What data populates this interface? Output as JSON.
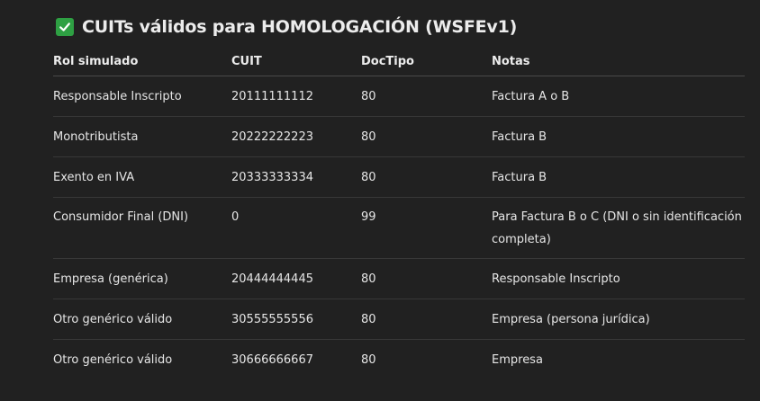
{
  "title": "CUITs válidos para HOMOLOGACIÓN (WSFEv1)",
  "title_icon": "check-mark-button-icon",
  "colors": {
    "background": "#212121",
    "check_green": "#2ea043",
    "text": "#ececec"
  },
  "table": {
    "headers": [
      "Rol simulado",
      "CUIT",
      "DocTipo",
      "Notas"
    ],
    "rows": [
      [
        "Responsable Inscripto",
        "20111111112",
        "80",
        "Factura A o B"
      ],
      [
        "Monotributista",
        "20222222223",
        "80",
        "Factura B"
      ],
      [
        "Exento en IVA",
        "20333333334",
        "80",
        "Factura B"
      ],
      [
        "Consumidor Final (DNI)",
        "0",
        "99",
        "Para Factura B o C (DNI o sin identificación completa)"
      ],
      [
        "Empresa (genérica)",
        "20444444445",
        "80",
        "Responsable Inscripto"
      ],
      [
        "Otro genérico válido",
        "30555555556",
        "80",
        "Empresa (persona jurídica)"
      ],
      [
        "Otro genérico válido",
        "30666666667",
        "80",
        "Empresa"
      ]
    ]
  }
}
